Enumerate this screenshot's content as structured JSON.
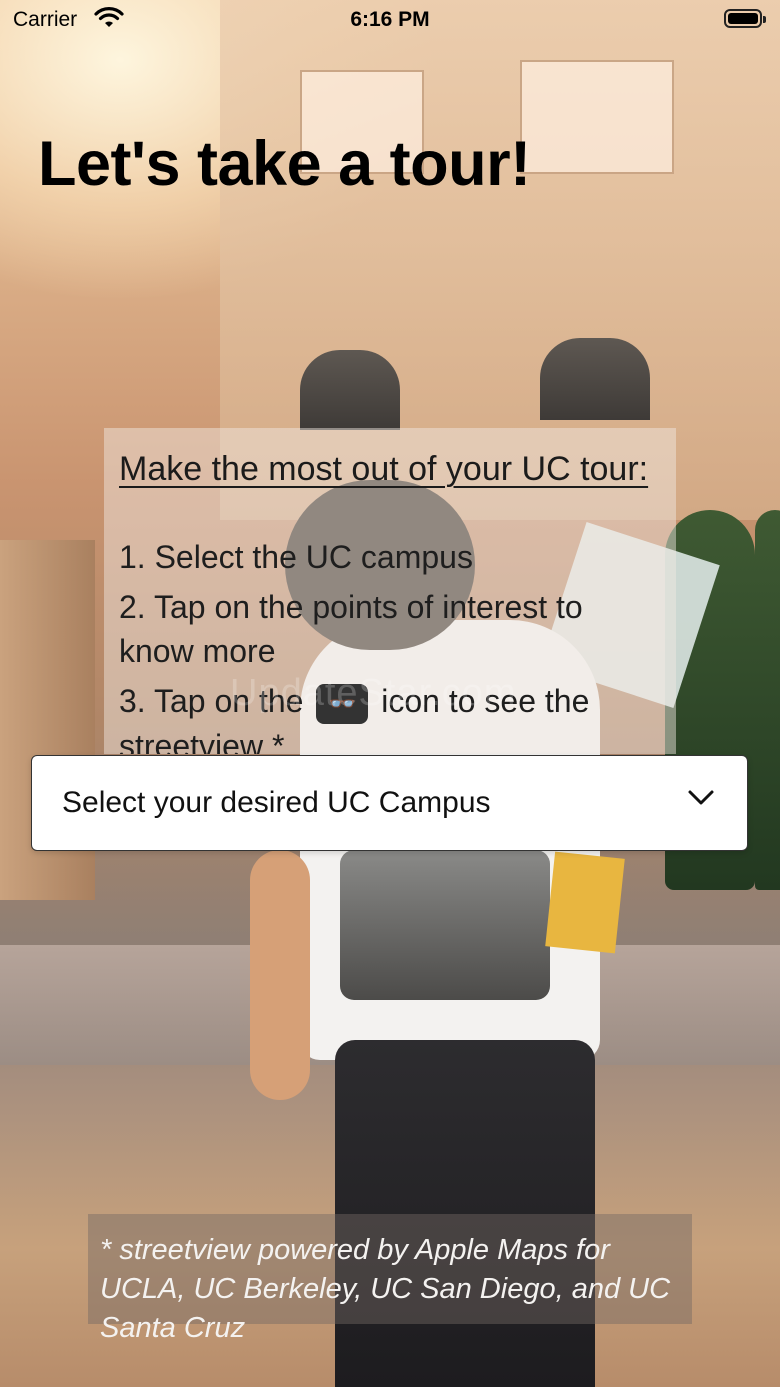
{
  "status_bar": {
    "carrier": "Carrier",
    "time": "6:16 PM"
  },
  "page": {
    "title": "Let's take a tour!"
  },
  "info_card": {
    "heading": "Make the most out of your UC tour:",
    "steps": [
      "1. Select the UC campus",
      "2. Tap on the points of interest to know more",
      "3. Tap on the",
      "icon to see the streetview *"
    ],
    "step3_icon_glyph": "👓"
  },
  "watermark": "UpdateStar.com",
  "campus_select": {
    "selected_label": "Select your desired UC Campus"
  },
  "footnote": "* streetview powered by Apple Maps for UCLA, UC Berkeley, UC San Diego, and UC Santa Cruz",
  "icons": {
    "wifi": "wifi-icon",
    "battery": "battery-icon",
    "chevron": "chevron-down-icon",
    "streetview": "binoculars-icon"
  }
}
